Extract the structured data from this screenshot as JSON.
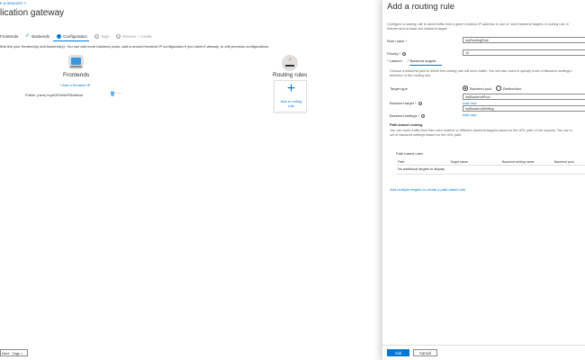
{
  "left": {
    "breadcrumb": "e a resource  >",
    "title": "lication gateway",
    "title_more": "···",
    "steps": [
      {
        "label": "Frontends",
        "mark": "",
        "state": "none"
      },
      {
        "label": "Backends",
        "mark": "✓",
        "state": "done"
      },
      {
        "label": "Configuration",
        "mark": "",
        "state": "current"
      },
      {
        "label": "Tags",
        "mark": "5",
        "state": "future"
      },
      {
        "label": "Review + create",
        "mark": "6",
        "state": "future"
      }
    ],
    "intro": "that link your frontend(s) and backend(s). You can add more backend pools, add a second frontend IP configuration if you haven't already, or edit previous configurations.",
    "frontends": {
      "title": "Frontends",
      "add_label": "+ Add a frontend IP",
      "row_label": "Public: (new) myAGPublicIPAddress",
      "row_actions": "···"
    },
    "routing": {
      "title": "Routing rules",
      "add_icon": "+",
      "add_line1": "Add a routing",
      "add_line2": "rule"
    },
    "next_label": "Next : Tags >"
  },
  "blade": {
    "title": "Add a routing rule",
    "desc_line1": "Configure a routing rule to send traffic from a given frontend IP address to one or more backend targets. A routing rule m",
    "desc_line2": "listener and at least one backend target.",
    "rule_name_label": "Rule name *",
    "rule_name_value": "myRoutingRule",
    "priority_label": "Priority *",
    "priority_value": "10",
    "tabs": [
      "* Listener",
      "* Backend targets"
    ],
    "backend_desc_line1": "Choose a backend pool to which this routing rule will send traffic. You will also need to specify a set of Backend settings t",
    "backend_desc_line2": "behavior of the routing rule.",
    "target_type_label": "Target type",
    "target_type_options": [
      "Backend pool",
      "Redirection"
    ],
    "backend_target_label": "Backend target *",
    "backend_target_value": "myBackendPool",
    "add_new_1": "Add new",
    "backend_settings_label": "Backend settings *",
    "backend_settings_value": "myBackendSetting",
    "add_new_2": "Add new",
    "path_routing_heading": "Path-based routing",
    "path_desc_line1": "You can route traffic from this rule's listener to different backend targets based on the URL path of the request. You can a",
    "path_desc_line2": "set of Backend settings based on the URL path.",
    "path_rules": {
      "title": "Path based rules",
      "columns": [
        "Path",
        "Target name",
        "Backend setting name",
        "Backend pool"
      ],
      "empty": "No additional targets to display"
    },
    "add_multiple_link": "Add multiple targets to create a path-based rule",
    "add_button": "Add",
    "cancel_button": "Cancel"
  },
  "colors": {
    "accent": "#0078d4",
    "text": "#323130",
    "muted": "#605e5c",
    "border": "#8a8886"
  }
}
